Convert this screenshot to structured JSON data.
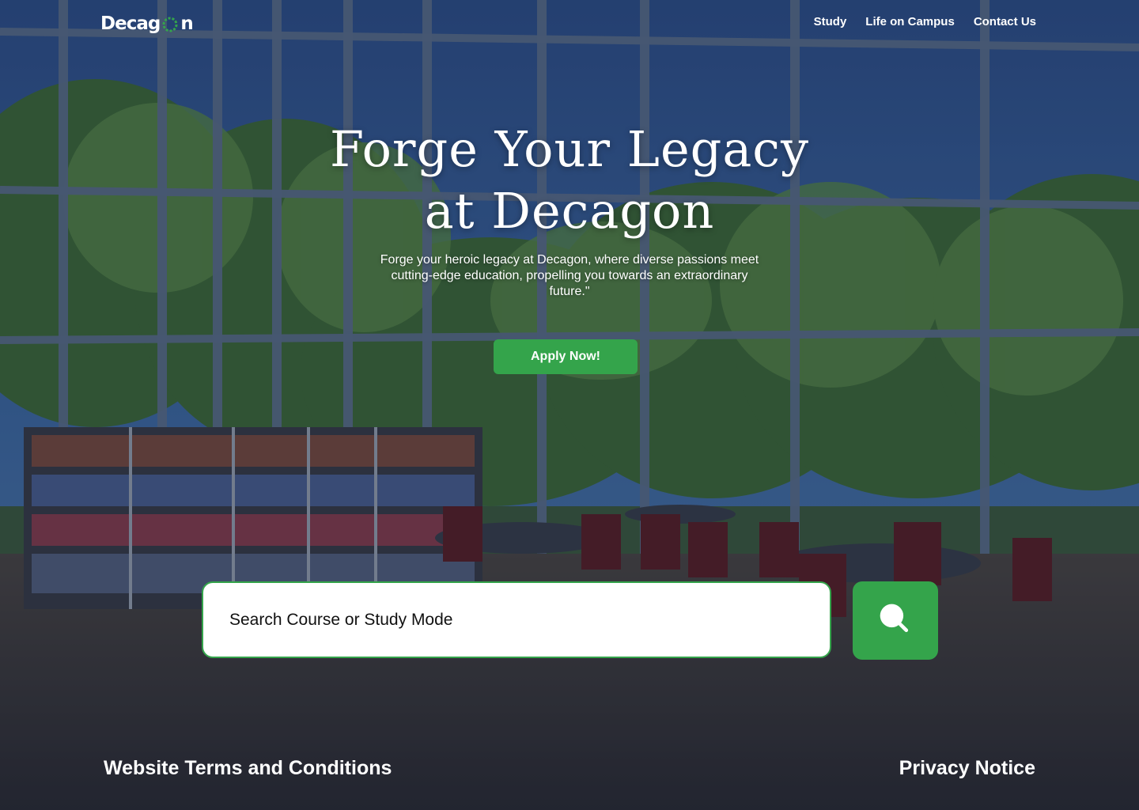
{
  "brand": {
    "logo_text_before": "Decag",
    "logo_text_after": "n",
    "accent_color": "#34a44b"
  },
  "nav": {
    "items": [
      {
        "label": "Study"
      },
      {
        "label": "Life on Campus"
      },
      {
        "label": "Contact Us"
      }
    ]
  },
  "hero": {
    "title_line1": "Forge Your Legacy",
    "title_line2": "at Decagon",
    "subtitle": "Forge your heroic legacy at Decagon, where diverse passions meet cutting-edge education, propelling you towards an extraordinary future.\"",
    "cta_label": "Apply Now!"
  },
  "search": {
    "placeholder": "Search Course or Study Mode",
    "button_icon": "search-icon"
  },
  "footer": {
    "terms_label": "Website Terms and Conditions",
    "privacy_label": "Privacy Notice"
  }
}
